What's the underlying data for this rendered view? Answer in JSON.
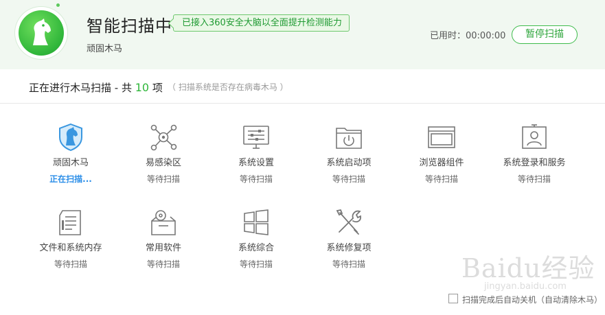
{
  "header": {
    "title": "智能扫描中",
    "badge": "已接入360安全大脑以全面提升检测能力",
    "subtitle": "顽固木马",
    "elapsed_label": "已用时：00:00:00",
    "pause_button": "暂停扫描"
  },
  "progress": {
    "prefix": "正在进行木马扫描 - 共 ",
    "count": "10",
    "suffix": " 项",
    "hint": "（ 扫描系统是否存在病毒木马 ）"
  },
  "items": [
    {
      "label": "顽固木马",
      "status": "正在扫描...",
      "icon": "shield-horse-icon"
    },
    {
      "label": "易感染区",
      "status": "等待扫描",
      "icon": "infection-nodes-icon"
    },
    {
      "label": "系统设置",
      "status": "等待扫描",
      "icon": "monitor-sliders-icon"
    },
    {
      "label": "系统启动项",
      "status": "等待扫描",
      "icon": "folder-power-icon"
    },
    {
      "label": "浏览器组件",
      "status": "等待扫描",
      "icon": "browser-window-icon"
    },
    {
      "label": "系统登录和服务",
      "status": "等待扫描",
      "icon": "user-badge-icon"
    },
    {
      "label": "文件和系统内存",
      "status": "等待扫描",
      "icon": "document-icon"
    },
    {
      "label": "常用软件",
      "status": "等待扫描",
      "icon": "software-box-icon"
    },
    {
      "label": "系统综合",
      "status": "等待扫描",
      "icon": "windows-logo-icon"
    },
    {
      "label": "系统修复项",
      "status": "等待扫描",
      "icon": "wrench-screwdriver-icon"
    }
  ],
  "footer": {
    "shutdown_option": "扫描完成后自动关机（自动清除木马）"
  },
  "watermark": {
    "main": "Baidu经验",
    "sub": "jingyan.baidu.com"
  },
  "colors": {
    "accent": "#2fb63a",
    "scanning": "#2b8ee8",
    "header_bg": "#f1f8f1"
  }
}
